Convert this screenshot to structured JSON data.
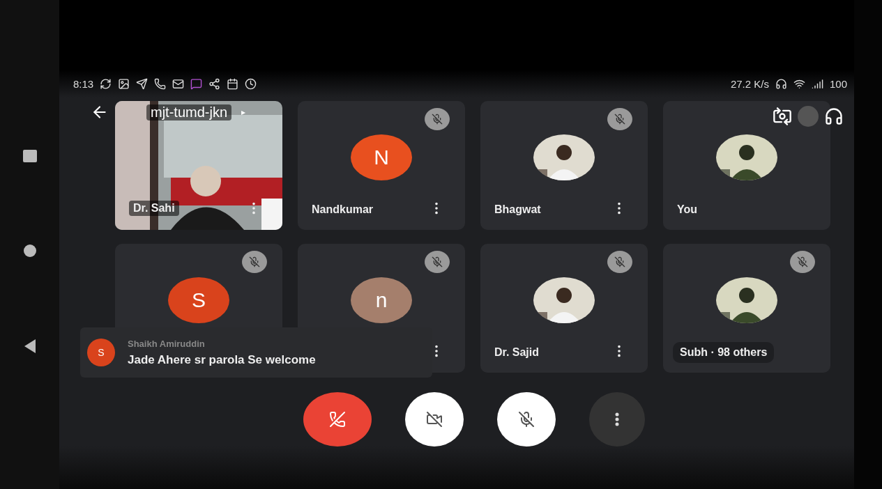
{
  "status_bar": {
    "time": "8:13",
    "speed": "27.2 K/s",
    "battery": "100"
  },
  "meeting": {
    "code": "mjt-tumd-jkn",
    "caret": "▸"
  },
  "tiles": [
    {
      "kind": "video",
      "name": "Dr. Sahi",
      "muted": false,
      "menu": true
    },
    {
      "kind": "letter",
      "initial": "N",
      "color": "#e8501f",
      "name": "Nandkumar",
      "muted": true,
      "menu": true
    },
    {
      "name": "Bhagwat",
      "muted": true,
      "menu": true
    },
    {
      "name": "You",
      "muted": false,
      "menu": false
    },
    {
      "kind": "letter",
      "initial": "S",
      "color": "#d9431c",
      "muted": true,
      "menu": false
    },
    {
      "kind": "letter",
      "initial": "n",
      "color": "#a57f6c",
      "muted": true,
      "menu": true
    },
    {
      "name": "Dr. Sajid",
      "muted": true,
      "menu": true
    },
    {
      "name": "Subh · 98 others",
      "muted": true,
      "menu": false
    }
  ],
  "chat_toast": {
    "initial": "S",
    "sender": "Shaikh Amiruddin",
    "message": "Jade Ahere sr parola Se welcome"
  },
  "controls": [
    {
      "kind": "end"
    },
    {
      "kind": "camera"
    },
    {
      "kind": "mic"
    },
    {
      "kind": "more"
    }
  ]
}
